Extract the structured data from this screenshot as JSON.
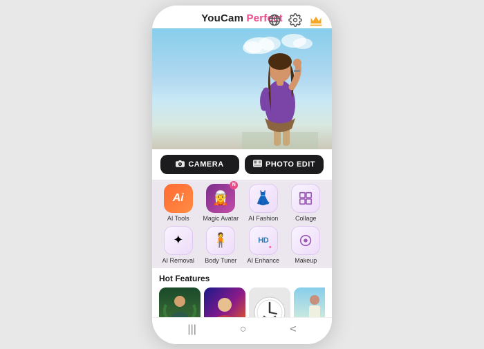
{
  "header": {
    "title_youcam": "YouCam",
    "title_perfect": " Perfect",
    "icons": [
      "explore-icon",
      "settings-icon",
      "crown-icon"
    ]
  },
  "action_buttons": {
    "camera_label": "CAMERA",
    "photo_edit_label": "PHOTO EDIT"
  },
  "features": [
    {
      "id": "ai-tools",
      "label": "AI Tools",
      "icon": "🤖",
      "bg": "bg-ai",
      "badge": false
    },
    {
      "id": "magic-avatar",
      "label": "Magic Avatar",
      "icon": "🎭",
      "bg": "bg-avatar",
      "badge": true
    },
    {
      "id": "ai-fashion",
      "label": "AI Fashion",
      "icon": "👗",
      "bg": "bg-fashion",
      "badge": false
    },
    {
      "id": "collage",
      "label": "Collage",
      "icon": "🖼",
      "bg": "bg-collage",
      "badge": false
    },
    {
      "id": "ai-removal",
      "label": "AI Removal",
      "icon": "✨",
      "bg": "bg-removal",
      "badge": false
    },
    {
      "id": "body-tuner",
      "label": "Body Tuner",
      "icon": "🧍",
      "bg": "bg-body",
      "badge": false
    },
    {
      "id": "ai-enhance",
      "label": "AI Enhance",
      "icon": "HD",
      "bg": "bg-enhance",
      "badge": false
    },
    {
      "id": "makeup",
      "label": "Makeup",
      "icon": "💄",
      "bg": "bg-makeup",
      "badge": false
    }
  ],
  "hot_features": {
    "title": "Hot Features",
    "thumbs": [
      {
        "id": "thumb-fantasy",
        "type": "1"
      },
      {
        "id": "thumb-art",
        "type": "2"
      },
      {
        "id": "thumb-clock",
        "type": "3"
      },
      {
        "id": "thumb-street",
        "type": "4"
      },
      {
        "id": "thumb-hat",
        "type": "5"
      },
      {
        "id": "thumb-partial",
        "type": "partial"
      }
    ]
  },
  "bottom_nav": {
    "icons": [
      "|||",
      "○",
      "<"
    ]
  }
}
